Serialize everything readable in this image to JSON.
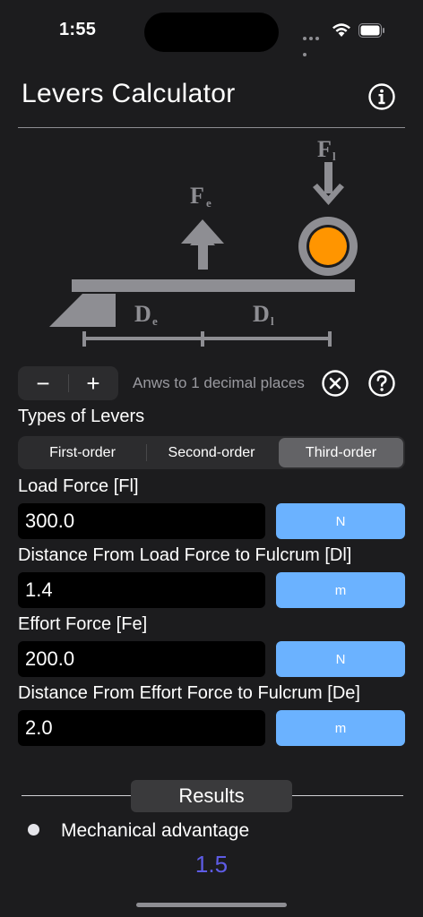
{
  "status_bar": {
    "time": "1:55"
  },
  "header": {
    "title": "Levers Calculator"
  },
  "diagram": {
    "load_force_label": "F",
    "load_force_sub": "l",
    "effort_force_label": "F",
    "effort_force_sub": "e",
    "effort_distance_label": "D",
    "effort_distance_sub": "e",
    "load_distance_label": "D",
    "load_distance_sub": "l",
    "load_color": "#ff9500",
    "beam_color": "#8e8e93"
  },
  "precision": {
    "minus_label": "−",
    "plus_label": "+",
    "text": "Anws to 1 decimal places"
  },
  "lever_types": {
    "label": "Types of Levers",
    "options": [
      "First-order",
      "Second-order",
      "Third-order"
    ],
    "selected": "Third-order"
  },
  "fields": [
    {
      "label": "Load Force [Fl]",
      "value": "300.0",
      "unit": "N"
    },
    {
      "label": "Distance From Load Force to Fulcrum [Dl]",
      "value": "1.4",
      "unit": "m"
    },
    {
      "label": "Effort Force [Fe]",
      "value": "200.0",
      "unit": "N"
    },
    {
      "label": "Distance From Effort Force to Fulcrum [De]",
      "value": "2.0",
      "unit": "m"
    }
  ],
  "results": {
    "header": "Results",
    "mechanical_advantage_label": "Mechanical advantage",
    "mechanical_advantage_value": "1.5",
    "value_color": "#5e5ce6"
  },
  "colors": {
    "background": "#1c1c1e",
    "accent": "#6bb2ff"
  }
}
